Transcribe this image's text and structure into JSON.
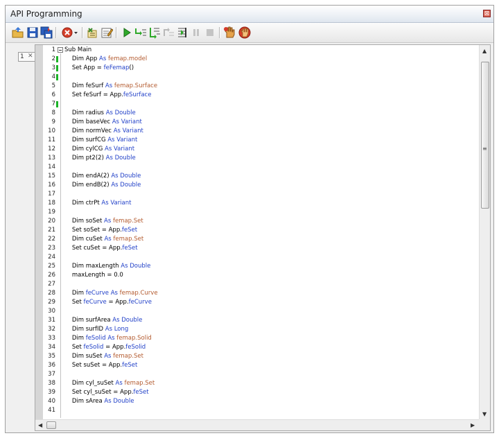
{
  "window": {
    "title": "API Programming",
    "close_glyph": "⊠"
  },
  "toolbar": {
    "buttons": [
      {
        "name": "open-folder-icon"
      },
      {
        "name": "save-icon"
      },
      {
        "name": "save-all-icon"
      },
      {
        "name": "cancel-dropdown-icon"
      },
      {
        "name": "references-icon"
      },
      {
        "name": "edit-icon"
      },
      {
        "name": "run-icon"
      },
      {
        "name": "step-into-icon"
      },
      {
        "name": "step-over-icon"
      },
      {
        "name": "step-out-icon"
      },
      {
        "name": "run-to-cursor-icon"
      },
      {
        "name": "pause-icon"
      },
      {
        "name": "stop-icon"
      },
      {
        "name": "breakpoint-hand-icon"
      },
      {
        "name": "clear-breakpoints-icon"
      }
    ]
  },
  "tab": {
    "number": "1",
    "close": "✕"
  },
  "editor": {
    "lines": [
      {
        "n": "1",
        "text": "Sub Main"
      },
      {
        "n": "2",
        "text": "    Dim App As femap.model"
      },
      {
        "n": "3",
        "text": "    Set App = feFemap()"
      },
      {
        "n": "4",
        "text": ""
      },
      {
        "n": "5",
        "text": "    Dim feSurf As femap.Surface"
      },
      {
        "n": "6",
        "text": "    Set feSurf = App.feSurface"
      },
      {
        "n": "7",
        "text": ""
      },
      {
        "n": "8",
        "text": "    Dim radius As Double"
      },
      {
        "n": "9",
        "text": "    Dim baseVec As Variant"
      },
      {
        "n": "10",
        "text": "    Dim normVec As Variant"
      },
      {
        "n": "11",
        "text": "    Dim surfCG As Variant"
      },
      {
        "n": "12",
        "text": "    Dim cylCG As Variant"
      },
      {
        "n": "13",
        "text": "    Dim pt2(2) As Double"
      },
      {
        "n": "14",
        "text": ""
      },
      {
        "n": "15",
        "text": "    Dim endA(2) As Double"
      },
      {
        "n": "16",
        "text": "    Dim endB(2) As Double"
      },
      {
        "n": "17",
        "text": ""
      },
      {
        "n": "18",
        "text": "    Dim ctrPt As Variant"
      },
      {
        "n": "19",
        "text": ""
      },
      {
        "n": "20",
        "text": "    Dim soSet As femap.Set"
      },
      {
        "n": "21",
        "text": "    Set soSet = App.feSet"
      },
      {
        "n": "22",
        "text": "    Dim cuSet As femap.Set"
      },
      {
        "n": "23",
        "text": "    Set cuSet = App.feSet"
      },
      {
        "n": "24",
        "text": ""
      },
      {
        "n": "25",
        "text": "    Dim maxLength As Double"
      },
      {
        "n": "26",
        "text": "    maxLength = 0.0"
      },
      {
        "n": "27",
        "text": ""
      },
      {
        "n": "28",
        "text": "    Dim feCurve As femap.Curve"
      },
      {
        "n": "29",
        "text": "    Set feCurve = App.feCurve"
      },
      {
        "n": "30",
        "text": ""
      },
      {
        "n": "31",
        "text": "    Dim surfArea As Double"
      },
      {
        "n": "32",
        "text": "    Dim surfID As Long"
      },
      {
        "n": "33",
        "text": "    Dim feSolid As femap.Solid"
      },
      {
        "n": "34",
        "text": "    Set feSolid = App.feSolid"
      },
      {
        "n": "35",
        "text": "    Dim suSet As femap.Set"
      },
      {
        "n": "36",
        "text": "    Set suSet = App.feSet"
      },
      {
        "n": "37",
        "text": ""
      },
      {
        "n": "38",
        "text": "    Dim cyl_suSet As femap.Set"
      },
      {
        "n": "39",
        "text": "    Set cyl_suSet = App.feSet"
      },
      {
        "n": "40",
        "text": "    Dim sArea As Double"
      },
      {
        "n": "41",
        "text": ""
      }
    ],
    "modified_lines": [
      "2",
      "3",
      "4",
      "7"
    ]
  },
  "colors": {
    "keyword": "#2140c8",
    "type": "#b35a2e",
    "modified": "#1bb327"
  }
}
